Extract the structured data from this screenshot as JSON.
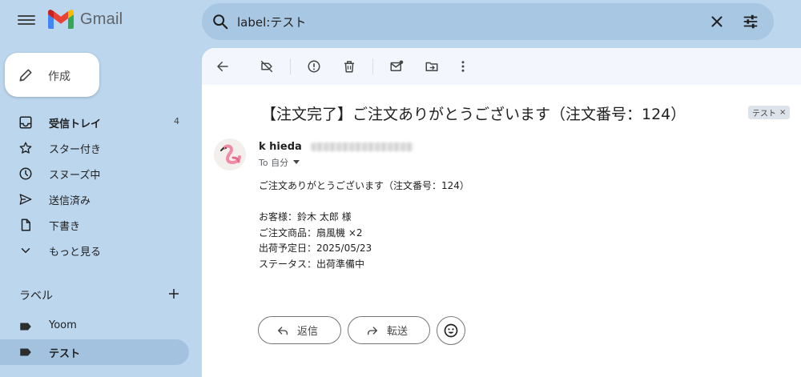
{
  "app": {
    "name": "Gmail"
  },
  "colors": {
    "accent": "#0b57d0",
    "background": "#bcd6ee",
    "active_nav": "#a3c2e0",
    "search_bg": "#a8c7e2"
  },
  "search": {
    "query": "label:テスト"
  },
  "compose": {
    "label": "作成"
  },
  "sidebar": {
    "items": [
      {
        "label": "受信トレイ",
        "count": "4",
        "icon": "inbox-icon"
      },
      {
        "label": "スター付き",
        "icon": "star-icon"
      },
      {
        "label": "スヌーズ中",
        "icon": "clock-icon"
      },
      {
        "label": "送信済み",
        "icon": "send-icon"
      },
      {
        "label": "下書き",
        "icon": "draft-icon"
      },
      {
        "label": "もっと見る",
        "icon": "chevron-down-icon"
      }
    ],
    "labels_heading": "ラベル",
    "labels": [
      {
        "label": "Yoom",
        "icon": "label-icon"
      },
      {
        "label": "テスト",
        "icon": "label-icon"
      }
    ]
  },
  "email": {
    "subject": "【注文完了】ご注文ありがとうございます（注文番号：124）",
    "label_chip": "テスト",
    "sender_name": "k hieda",
    "to": "To 自分",
    "body": [
      "ご注文ありがとうございます（注文番号：124）",
      "",
      "お客様：鈴木 太郎  様",
      "ご注文商品：扇風機 ×2",
      "出荷予定日：2025/05/23",
      "ステータス：出荷準備中"
    ]
  },
  "actions": {
    "reply": "返信",
    "forward": "転送"
  }
}
